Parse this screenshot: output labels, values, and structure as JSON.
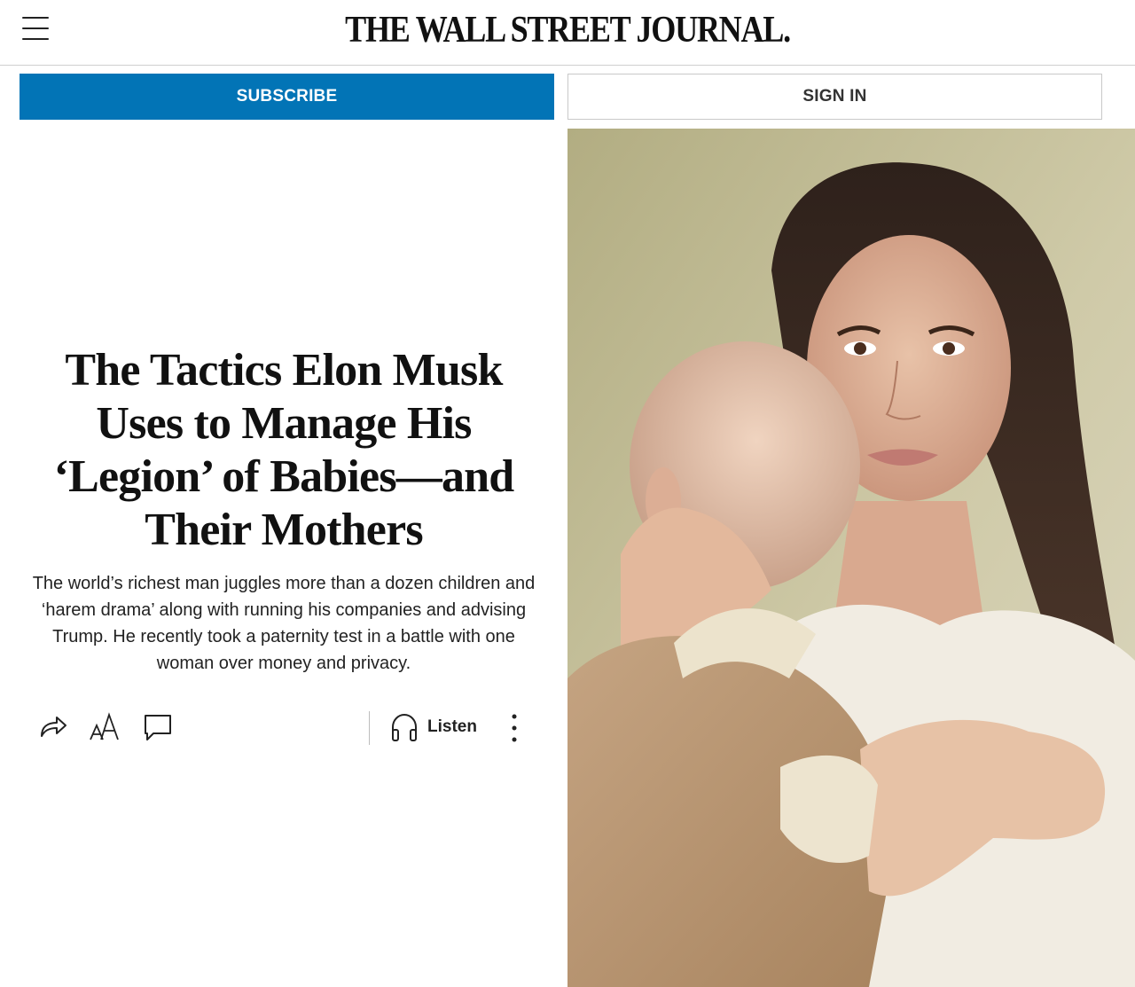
{
  "header": {
    "masthead": "THE WALL STREET JOURNAL.",
    "menu_icon": "hamburger-menu-icon"
  },
  "actions": {
    "subscribe_label": "SUBSCRIBE",
    "signin_label": "SIGN IN",
    "subscribe_color": "#0274b6"
  },
  "article": {
    "headline": "The Tactics Elon Musk Uses to Manage His ‘Legion’ of Babies—and Their Mothers",
    "dek": "The world’s richest man juggles more than a dozen children and ‘harem drama’ along with running his companies and advising Trump. He recently took a paternity test in a battle with one woman over money and privacy."
  },
  "toolbar": {
    "share_icon": "share-icon",
    "text_size_icon": "text-size-icon",
    "comment_icon": "comment-icon",
    "listen_icon": "headphones-icon",
    "listen_label": "Listen",
    "more_icon": "more-vertical-icon"
  }
}
